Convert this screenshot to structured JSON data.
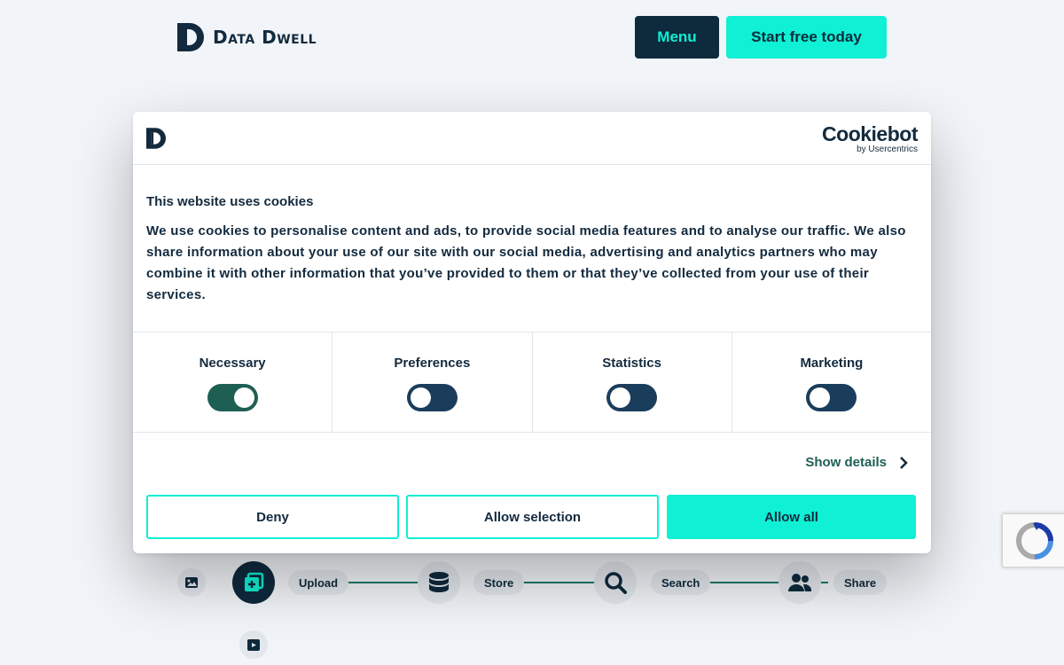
{
  "header": {
    "brand": "Data Dwell",
    "menu_label": "Menu",
    "cta_label": "Start free today"
  },
  "dialog": {
    "provider_name": "Cookiebot",
    "provider_sub": "by Usercentrics",
    "title": "This website uses cookies",
    "text": "We use cookies to personalise content and ads, to provide social media features and to analyse our traffic. We also share information about your use of our site with our social media, advertising and analytics partners who may combine it with other information that you’ve provided to them or that they’ve collected from your use of their services.",
    "categories": [
      {
        "label": "Necessary",
        "enabled": true
      },
      {
        "label": "Preferences",
        "enabled": false
      },
      {
        "label": "Statistics",
        "enabled": false
      },
      {
        "label": "Marketing",
        "enabled": false
      }
    ],
    "show_details_label": "Show details",
    "deny_label": "Deny",
    "allow_selection_label": "Allow selection",
    "allow_all_label": "Allow all"
  },
  "workflow": {
    "steps": [
      {
        "label": "Upload",
        "icon": "upload-icon"
      },
      {
        "label": "Store",
        "icon": "database-icon"
      },
      {
        "label": "Search",
        "icon": "search-icon"
      },
      {
        "label": "Share",
        "icon": "users-icon"
      }
    ]
  },
  "colors": {
    "accent": "#0ff0d4",
    "navy": "#0e2a3d",
    "toggle_on": "#1e5f54",
    "toggle_off": "#1b3d5c",
    "background": "#f1f4f8"
  }
}
